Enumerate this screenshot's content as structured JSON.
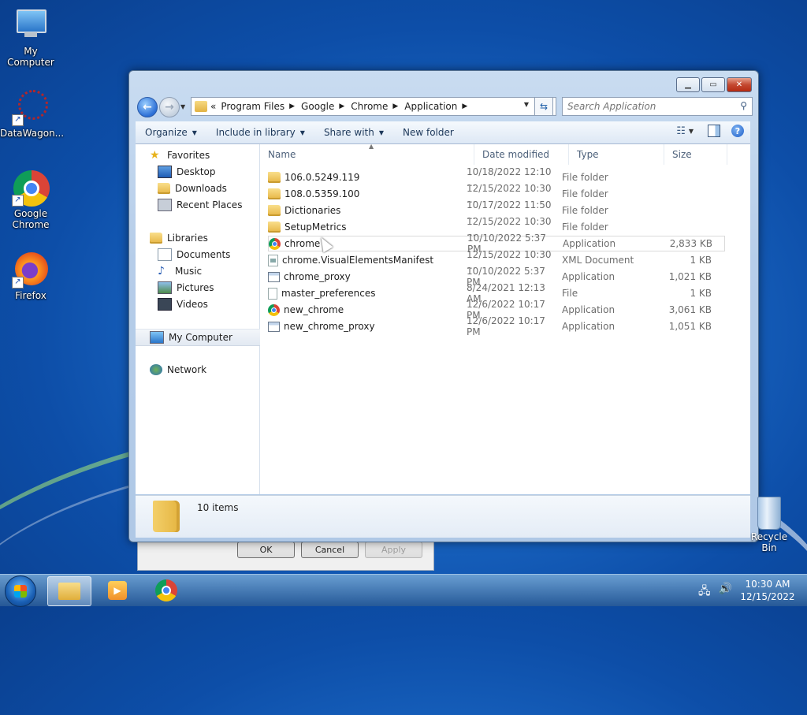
{
  "desktop": {
    "icons": [
      {
        "label": "My Computer"
      },
      {
        "label": "DataWagon..."
      },
      {
        "label": "Google Chrome"
      },
      {
        "label": "Firefox"
      }
    ],
    "recycle_bin": "Recycle Bin"
  },
  "explorer": {
    "address": {
      "prefix": "«",
      "crumbs": [
        "Program Files",
        "Google",
        "Chrome",
        "Application"
      ]
    },
    "search_placeholder": "Search Application",
    "commands": {
      "organize": "Organize",
      "include_in_library": "Include in library",
      "share_with": "Share with",
      "new_folder": "New folder"
    },
    "nav": {
      "favorites": "Favorites",
      "desktop": "Desktop",
      "downloads": "Downloads",
      "recent_places": "Recent Places",
      "libraries": "Libraries",
      "documents": "Documents",
      "music": "Music",
      "pictures": "Pictures",
      "videos": "Videos",
      "my_computer": "My Computer",
      "network": "Network"
    },
    "columns": {
      "name": "Name",
      "date_modified": "Date modified",
      "type": "Type",
      "size": "Size"
    },
    "files": [
      {
        "name": "106.0.5249.119",
        "date": "10/18/2022 12:10 ...",
        "type": "File folder",
        "size": "",
        "icon": "folder"
      },
      {
        "name": "108.0.5359.100",
        "date": "12/15/2022 10:30 ...",
        "type": "File folder",
        "size": "",
        "icon": "folder"
      },
      {
        "name": "Dictionaries",
        "date": "10/17/2022 11:50 ...",
        "type": "File folder",
        "size": "",
        "icon": "folder"
      },
      {
        "name": "SetupMetrics",
        "date": "12/15/2022 10:30 ...",
        "type": "File folder",
        "size": "",
        "icon": "folder"
      },
      {
        "name": "chrome",
        "date": "10/10/2022 5:37 PM",
        "type": "Application",
        "size": "2,833 KB",
        "icon": "chrome"
      },
      {
        "name": "chrome.VisualElementsManifest",
        "date": "12/15/2022 10:30 ...",
        "type": "XML Document",
        "size": "1 KB",
        "icon": "xml"
      },
      {
        "name": "chrome_proxy",
        "date": "10/10/2022 5:37 PM",
        "type": "Application",
        "size": "1,021 KB",
        "icon": "app"
      },
      {
        "name": "master_preferences",
        "date": "8/24/2021 12:13 AM",
        "type": "File",
        "size": "1 KB",
        "icon": "file"
      },
      {
        "name": "new_chrome",
        "date": "12/6/2022 10:17 PM",
        "type": "Application",
        "size": "3,061 KB",
        "icon": "chrome"
      },
      {
        "name": "new_chrome_proxy",
        "date": "12/6/2022 10:17 PM",
        "type": "Application",
        "size": "1,051 KB",
        "icon": "app"
      }
    ],
    "status": "10 items"
  },
  "dialog": {
    "ok": "OK",
    "cancel": "Cancel",
    "apply": "Apply"
  },
  "taskbar": {
    "time": "10:30 AM",
    "date": "12/15/2022"
  }
}
